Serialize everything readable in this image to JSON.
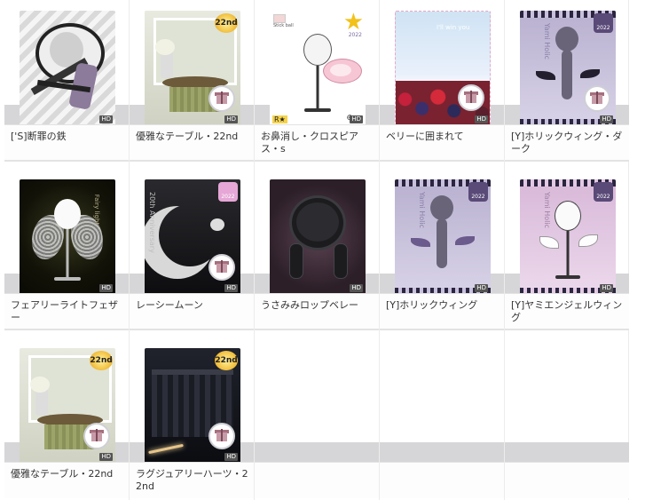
{
  "items": [
    {
      "label": "['S]断罪の鉄",
      "hd": "HD"
    },
    {
      "label": "優雅なテーブル・22nd",
      "hd": "HD",
      "badge": "22nd"
    },
    {
      "label": "お鼻消し・クロスピアス・s",
      "hd": "HD",
      "badge_text": "2022",
      "thumb_text": "Stick ball"
    },
    {
      "label": "ベリーに囲まれて",
      "hd": "HD",
      "thumb_text": "I'll win you"
    },
    {
      "label": "[Y]ホリックウィング・ダーク",
      "hd": "HD",
      "badge_text": "2022",
      "thumb_text": "Yami Holic"
    },
    {
      "label": "フェアリーライトフェザー",
      "hd": "HD",
      "thumb_text": "Fairy light"
    },
    {
      "label": "レーシームーン",
      "hd": "HD",
      "badge_text": "2022",
      "thumb_text": "20th Anniversary"
    },
    {
      "label": "うさみみロップベレー",
      "hd": "HD"
    },
    {
      "label": "[Y]ホリックウィング",
      "hd": "HD",
      "badge_text": "2022",
      "thumb_text": "Yami Holic"
    },
    {
      "label": "[Y]ヤミエンジェルウィング",
      "hd": "HD",
      "badge_text": "2022",
      "thumb_text": "Yami Holic"
    },
    {
      "label": "優雅なテーブル・22nd",
      "hd": "HD",
      "badge": "22nd"
    },
    {
      "label": "ラグジュアリーハーツ・22nd",
      "hd": "HD",
      "badge": "22nd"
    }
  ]
}
